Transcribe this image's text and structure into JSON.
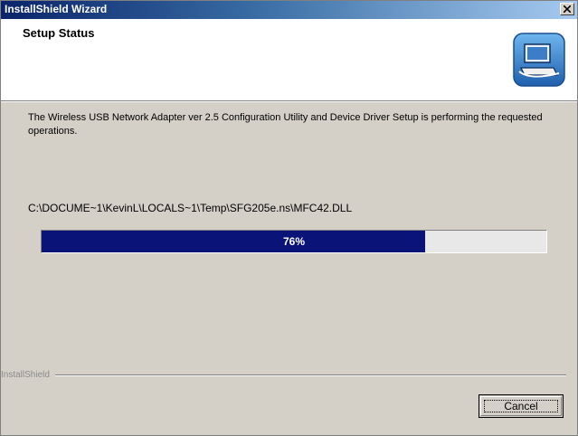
{
  "window": {
    "title": "InstallShield Wizard",
    "close_glyph": "×"
  },
  "header": {
    "title": "Setup Status",
    "icon": "computer-setup-icon"
  },
  "status": {
    "description": "The Wireless USB Network Adapter ver 2.5 Configuration Utility and Device Driver Setup is performing the requested operations.",
    "current_file": "C:\\DOCUME~1\\KevinL\\LOCALS~1\\Temp\\SFG205e.ns\\MFC42.DLL"
  },
  "progress": {
    "percent": 76,
    "label": "76%"
  },
  "footer": {
    "brand": "InstallShield",
    "cancel_label": "Cancel"
  },
  "colors": {
    "titlebar_start": "#0a246a",
    "progress_fill": "#0a1478",
    "dialog_bg": "#d4d0c8"
  }
}
